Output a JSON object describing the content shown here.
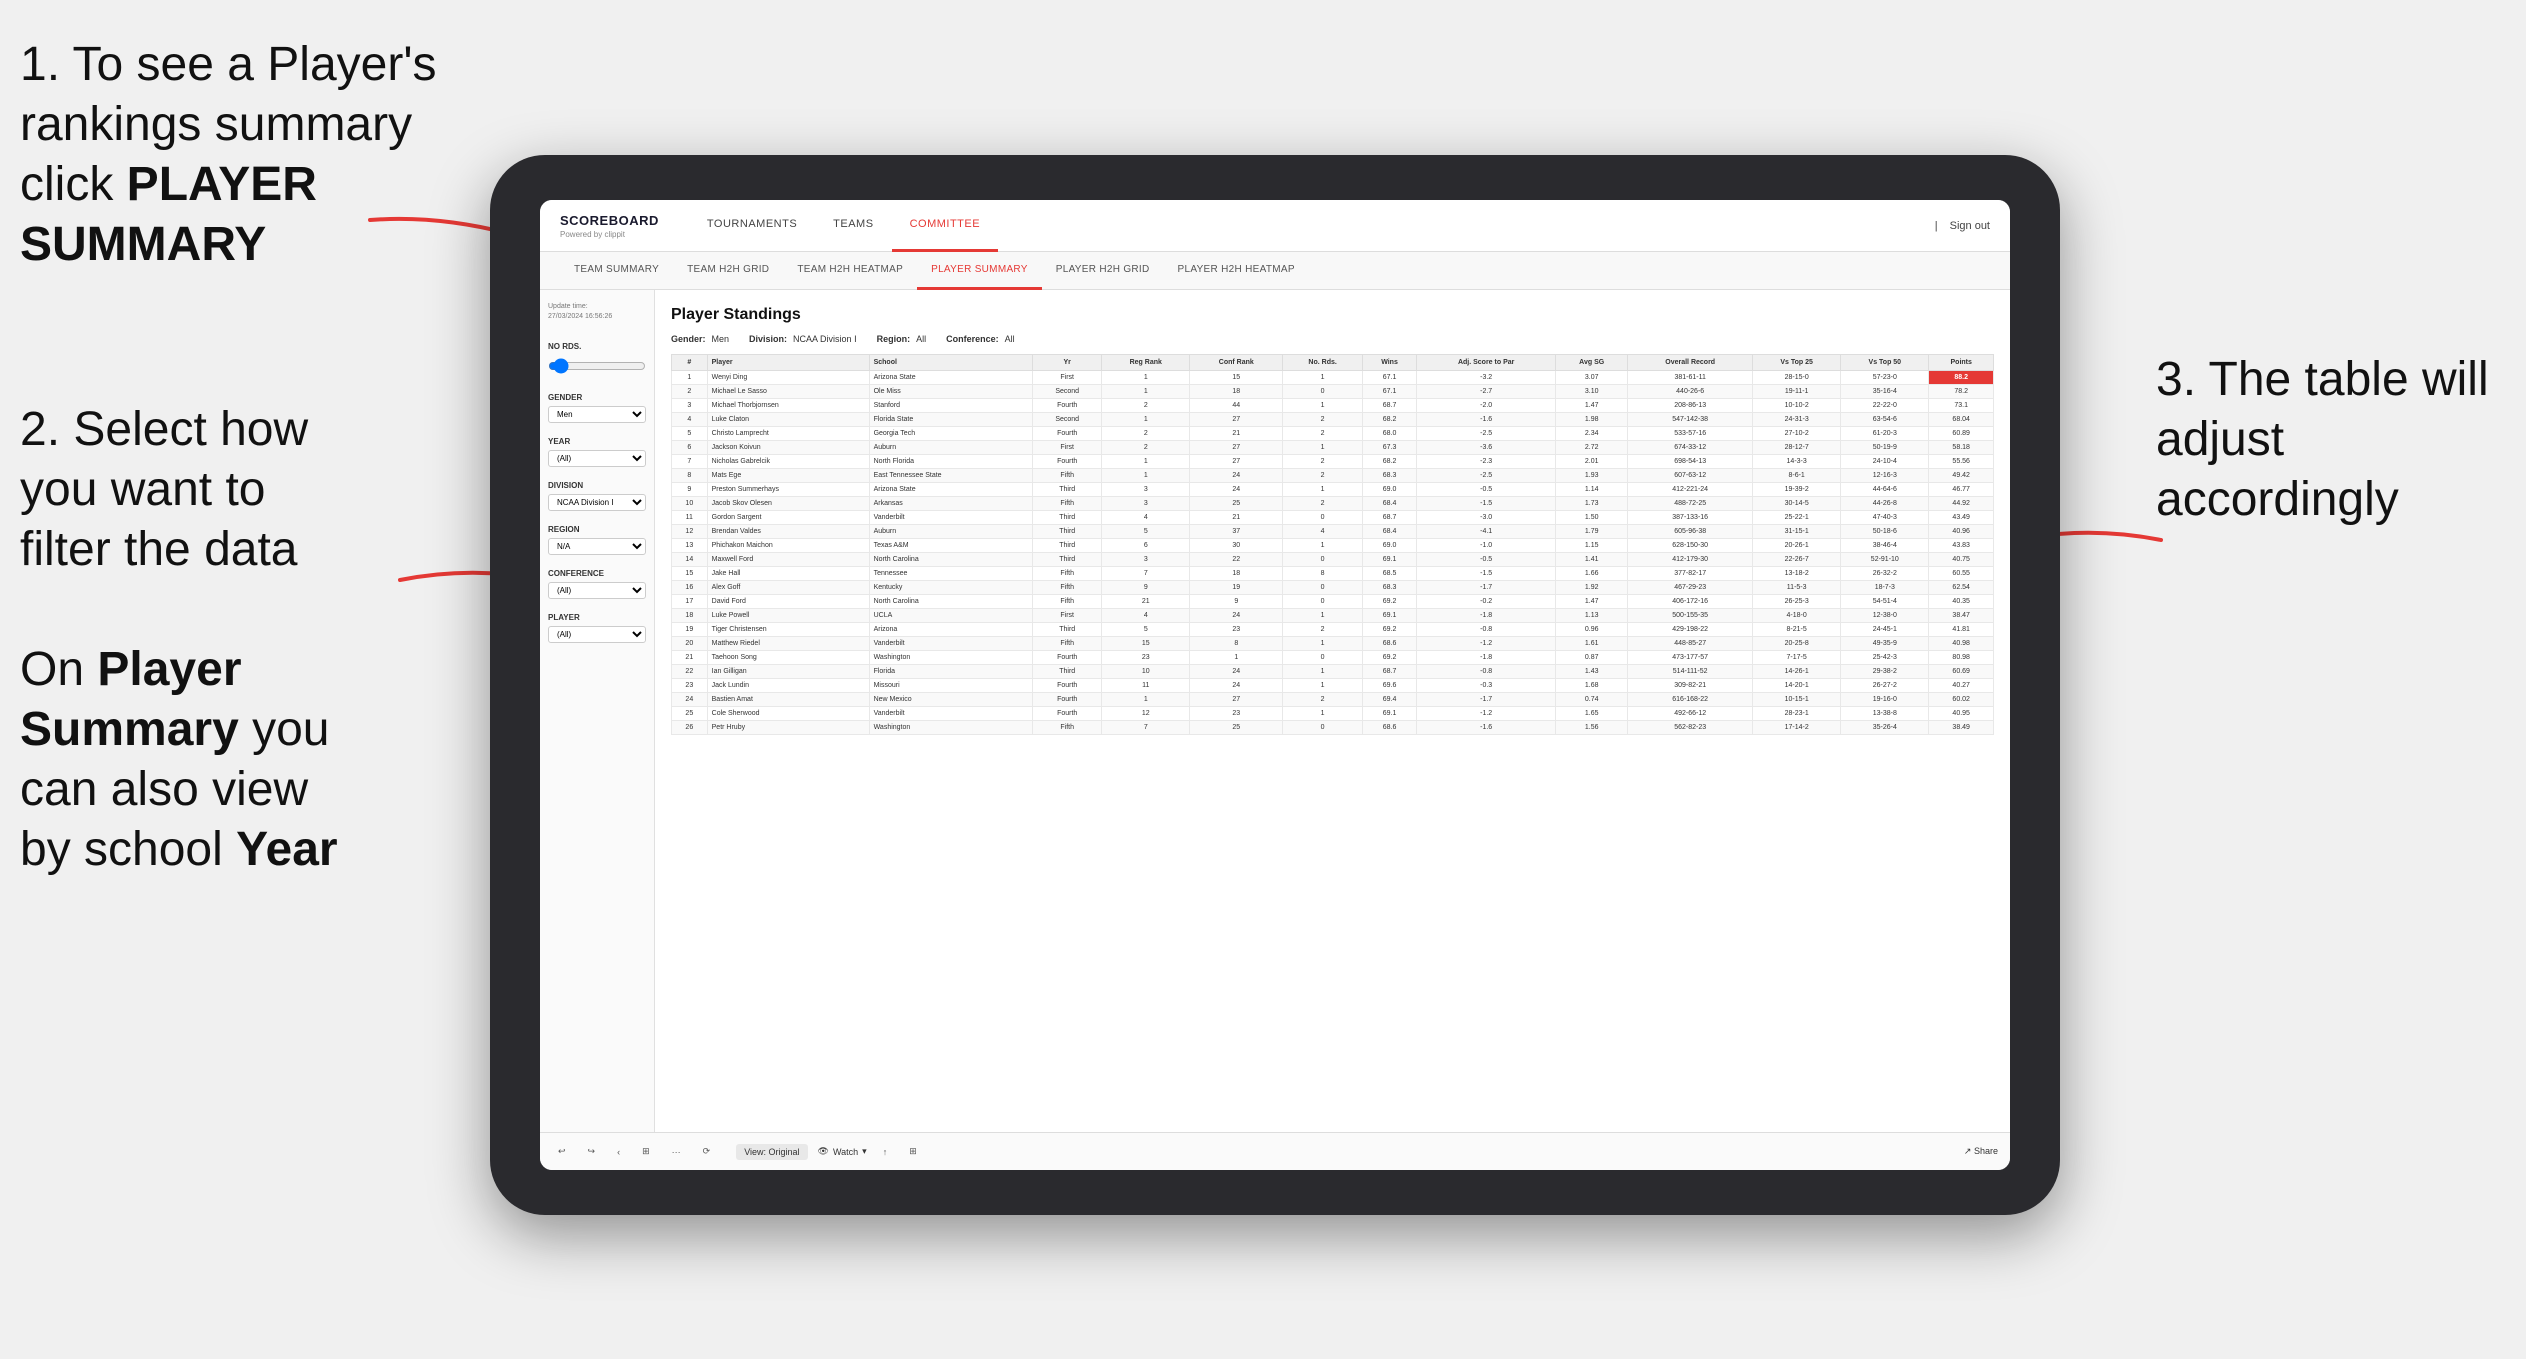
{
  "instructions": {
    "step1": "1. To see a Player's rankings summary click ",
    "step1_bold": "PLAYER SUMMARY",
    "step2_line1": "2. Select how",
    "step2_line2": "you want to",
    "step2_line3": "filter the data",
    "step3": "3. The table will adjust accordingly",
    "footer_line1": "On ",
    "footer_bold1": "Player",
    "footer_line2": "",
    "footer_bold2": "Summary",
    "footer_line3": " you",
    "footer_line4": "can also view",
    "footer_line5": "by school ",
    "footer_bold3": "Year"
  },
  "app": {
    "logo": "SCOREBOARD",
    "logo_sub": "Powered by clippit",
    "nav": [
      "TOURNAMENTS",
      "TEAMS",
      "COMMITTEE"
    ],
    "nav_active": "TEAMS",
    "header_right": [
      "Sign out"
    ],
    "subnav": [
      "TEAM SUMMARY",
      "TEAM H2H GRID",
      "TEAM H2H HEATMAP",
      "PLAYER SUMMARY",
      "PLAYER H2H GRID",
      "PLAYER H2H HEATMAP"
    ],
    "subnav_active": "PLAYER SUMMARY"
  },
  "sidebar": {
    "update_label": "Update time:",
    "update_time": "27/03/2024 16:56:26",
    "no_rds_label": "No Rds.",
    "gender_label": "Gender",
    "gender_value": "Men",
    "year_label": "Year",
    "year_value": "(All)",
    "division_label": "Division",
    "division_value": "NCAA Division I",
    "region_label": "Region",
    "region_value": "N/A",
    "conference_label": "Conference",
    "conference_value": "(All)",
    "player_label": "Player",
    "player_value": "(All)"
  },
  "standings": {
    "title": "Player Standings",
    "gender_label": "Gender:",
    "gender_value": "Men",
    "division_label": "Division:",
    "division_value": "NCAA Division I",
    "region_label": "Region:",
    "region_value": "All",
    "conference_label": "Conference:",
    "conference_value": "All",
    "columns": [
      "#",
      "Player",
      "School",
      "Yr",
      "Reg Rank",
      "Conf Rank",
      "No. Rds.",
      "Wins",
      "Adj. Score to Par",
      "Avg SG",
      "Overall Record",
      "Vs Top 25",
      "Vs Top 50",
      "Points"
    ],
    "players": [
      {
        "rank": "1",
        "name": "Wenyi Ding",
        "school": "Arizona State",
        "yr": "First",
        "reg_rank": "1",
        "conf_rank": "15",
        "rds": "1",
        "wins": "67.1",
        "adj": "-3.2",
        "sg": "3.07",
        "record": "381-61-11",
        "vt25": "28-15-0",
        "vt50": "57-23-0",
        "points": "88.2"
      },
      {
        "rank": "2",
        "name": "Michael Le Sasso",
        "school": "Ole Miss",
        "yr": "Second",
        "reg_rank": "1",
        "conf_rank": "18",
        "rds": "0",
        "wins": "67.1",
        "adj": "-2.7",
        "sg": "3.10",
        "record": "440-26-6",
        "vt25": "19-11-1",
        "vt50": "35-16-4",
        "points": "78.2"
      },
      {
        "rank": "3",
        "name": "Michael Thorbjornsen",
        "school": "Stanford",
        "yr": "Fourth",
        "reg_rank": "2",
        "conf_rank": "44",
        "rds": "1",
        "wins": "68.7",
        "adj": "-2.0",
        "sg": "1.47",
        "record": "208-86-13",
        "vt25": "10-10-2",
        "vt50": "22-22-0",
        "points": "73.1"
      },
      {
        "rank": "4",
        "name": "Luke Claton",
        "school": "Florida State",
        "yr": "Second",
        "reg_rank": "1",
        "conf_rank": "27",
        "rds": "2",
        "wins": "68.2",
        "adj": "-1.6",
        "sg": "1.98",
        "record": "547-142-38",
        "vt25": "24-31-3",
        "vt50": "63-54-6",
        "points": "68.04"
      },
      {
        "rank": "5",
        "name": "Christo Lamprecht",
        "school": "Georgia Tech",
        "yr": "Fourth",
        "reg_rank": "2",
        "conf_rank": "21",
        "rds": "2",
        "wins": "68.0",
        "adj": "-2.5",
        "sg": "2.34",
        "record": "533-57-16",
        "vt25": "27-10-2",
        "vt50": "61-20-3",
        "points": "60.89"
      },
      {
        "rank": "6",
        "name": "Jackson Koivun",
        "school": "Auburn",
        "yr": "First",
        "reg_rank": "2",
        "conf_rank": "27",
        "rds": "1",
        "wins": "67.3",
        "adj": "-3.6",
        "sg": "2.72",
        "record": "674-33-12",
        "vt25": "28-12-7",
        "vt50": "50-19-9",
        "points": "58.18"
      },
      {
        "rank": "7",
        "name": "Nicholas Gabrelcik",
        "school": "North Florida",
        "yr": "Fourth",
        "reg_rank": "1",
        "conf_rank": "27",
        "rds": "2",
        "wins": "68.2",
        "adj": "-2.3",
        "sg": "2.01",
        "record": "698-54-13",
        "vt25": "14-3-3",
        "vt50": "24-10-4",
        "points": "55.56"
      },
      {
        "rank": "8",
        "name": "Mats Ege",
        "school": "East Tennessee State",
        "yr": "Fifth",
        "reg_rank": "1",
        "conf_rank": "24",
        "rds": "2",
        "wins": "68.3",
        "adj": "-2.5",
        "sg": "1.93",
        "record": "607-63-12",
        "vt25": "8-6-1",
        "vt50": "12-16-3",
        "points": "49.42"
      },
      {
        "rank": "9",
        "name": "Preston Summerhays",
        "school": "Arizona State",
        "yr": "Third",
        "reg_rank": "3",
        "conf_rank": "24",
        "rds": "1",
        "wins": "69.0",
        "adj": "-0.5",
        "sg": "1.14",
        "record": "412-221-24",
        "vt25": "19-39-2",
        "vt50": "44-64-6",
        "points": "46.77"
      },
      {
        "rank": "10",
        "name": "Jacob Skov Olesen",
        "school": "Arkansas",
        "yr": "Fifth",
        "reg_rank": "3",
        "conf_rank": "25",
        "rds": "2",
        "wins": "68.4",
        "adj": "-1.5",
        "sg": "1.73",
        "record": "488-72-25",
        "vt25": "30-14-5",
        "vt50": "44-26-8",
        "points": "44.92"
      },
      {
        "rank": "11",
        "name": "Gordon Sargent",
        "school": "Vanderbilt",
        "yr": "Third",
        "reg_rank": "4",
        "conf_rank": "21",
        "rds": "0",
        "wins": "68.7",
        "adj": "-3.0",
        "sg": "1.50",
        "record": "387-133-16",
        "vt25": "25-22-1",
        "vt50": "47-40-3",
        "points": "43.49"
      },
      {
        "rank": "12",
        "name": "Brendan Valdes",
        "school": "Auburn",
        "yr": "Third",
        "reg_rank": "5",
        "conf_rank": "37",
        "rds": "4",
        "wins": "68.4",
        "adj": "-4.1",
        "sg": "1.79",
        "record": "605-96-38",
        "vt25": "31-15-1",
        "vt50": "50-18-6",
        "points": "40.96"
      },
      {
        "rank": "13",
        "name": "Phichakon Maichon",
        "school": "Texas A&M",
        "yr": "Third",
        "reg_rank": "6",
        "conf_rank": "30",
        "rds": "1",
        "wins": "69.0",
        "adj": "-1.0",
        "sg": "1.15",
        "record": "628-150-30",
        "vt25": "20-26-1",
        "vt50": "38-46-4",
        "points": "43.83"
      },
      {
        "rank": "14",
        "name": "Maxwell Ford",
        "school": "North Carolina",
        "yr": "Third",
        "reg_rank": "3",
        "conf_rank": "22",
        "rds": "0",
        "wins": "69.1",
        "adj": "-0.5",
        "sg": "1.41",
        "record": "412-179-30",
        "vt25": "22-26-7",
        "vt50": "52-91-10",
        "points": "40.75"
      },
      {
        "rank": "15",
        "name": "Jake Hall",
        "school": "Tennessee",
        "yr": "Fifth",
        "reg_rank": "7",
        "conf_rank": "18",
        "rds": "8",
        "wins": "68.5",
        "adj": "-1.5",
        "sg": "1.66",
        "record": "377-82-17",
        "vt25": "13-18-2",
        "vt50": "26-32-2",
        "points": "60.55"
      },
      {
        "rank": "16",
        "name": "Alex Goff",
        "school": "Kentucky",
        "yr": "Fifth",
        "reg_rank": "9",
        "conf_rank": "19",
        "rds": "0",
        "wins": "68.3",
        "adj": "-1.7",
        "sg": "1.92",
        "record": "467-29-23",
        "vt25": "11-5-3",
        "vt50": "18-7-3",
        "points": "62.54"
      },
      {
        "rank": "17",
        "name": "David Ford",
        "school": "North Carolina",
        "yr": "Fifth",
        "reg_rank": "21",
        "conf_rank": "9",
        "rds": "0",
        "wins": "69.2",
        "adj": "-0.2",
        "sg": "1.47",
        "record": "406-172-16",
        "vt25": "26-25-3",
        "vt50": "54-51-4",
        "points": "40.35"
      },
      {
        "rank": "18",
        "name": "Luke Powell",
        "school": "UCLA",
        "yr": "First",
        "reg_rank": "4",
        "conf_rank": "24",
        "rds": "1",
        "wins": "69.1",
        "adj": "-1.8",
        "sg": "1.13",
        "record": "500-155-35",
        "vt25": "4-18-0",
        "vt50": "12-38-0",
        "points": "38.47"
      },
      {
        "rank": "19",
        "name": "Tiger Christensen",
        "school": "Arizona",
        "yr": "Third",
        "reg_rank": "5",
        "conf_rank": "23",
        "rds": "2",
        "wins": "69.2",
        "adj": "-0.8",
        "sg": "0.96",
        "record": "429-198-22",
        "vt25": "8-21-5",
        "vt50": "24-45-1",
        "points": "41.81"
      },
      {
        "rank": "20",
        "name": "Matthew Riedel",
        "school": "Vanderbilt",
        "yr": "Fifth",
        "reg_rank": "15",
        "conf_rank": "8",
        "rds": "1",
        "wins": "68.6",
        "adj": "-1.2",
        "sg": "1.61",
        "record": "448-85-27",
        "vt25": "20-25-8",
        "vt50": "49-35-9",
        "points": "40.98"
      },
      {
        "rank": "21",
        "name": "Taehoon Song",
        "school": "Washington",
        "yr": "Fourth",
        "reg_rank": "23",
        "conf_rank": "1",
        "rds": "0",
        "wins": "69.2",
        "adj": "-1.8",
        "sg": "0.87",
        "record": "473-177-57",
        "vt25": "7-17-5",
        "vt50": "25-42-3",
        "points": "80.98"
      },
      {
        "rank": "22",
        "name": "Ian Gilligan",
        "school": "Florida",
        "yr": "Third",
        "reg_rank": "10",
        "conf_rank": "24",
        "rds": "1",
        "wins": "68.7",
        "adj": "-0.8",
        "sg": "1.43",
        "record": "514-111-52",
        "vt25": "14-26-1",
        "vt50": "29-38-2",
        "points": "60.69"
      },
      {
        "rank": "23",
        "name": "Jack Lundin",
        "school": "Missouri",
        "yr": "Fourth",
        "reg_rank": "11",
        "conf_rank": "24",
        "rds": "1",
        "wins": "69.6",
        "adj": "-0.3",
        "sg": "1.68",
        "record": "309-82-21",
        "vt25": "14-20-1",
        "vt50": "26-27-2",
        "points": "40.27"
      },
      {
        "rank": "24",
        "name": "Bastien Amat",
        "school": "New Mexico",
        "yr": "Fourth",
        "reg_rank": "1",
        "conf_rank": "27",
        "rds": "2",
        "wins": "69.4",
        "adj": "-1.7",
        "sg": "0.74",
        "record": "616-168-22",
        "vt25": "10-15-1",
        "vt50": "19-16-0",
        "points": "60.02"
      },
      {
        "rank": "25",
        "name": "Cole Sherwood",
        "school": "Vanderbilt",
        "yr": "Fourth",
        "reg_rank": "12",
        "conf_rank": "23",
        "rds": "1",
        "wins": "69.1",
        "adj": "-1.2",
        "sg": "1.65",
        "record": "492-66-12",
        "vt25": "28-23-1",
        "vt50": "13-38-8",
        "points": "40.95"
      },
      {
        "rank": "26",
        "name": "Petr Hruby",
        "school": "Washington",
        "yr": "Fifth",
        "reg_rank": "7",
        "conf_rank": "25",
        "rds": "0",
        "wins": "68.6",
        "adj": "-1.6",
        "sg": "1.56",
        "record": "562-82-23",
        "vt25": "17-14-2",
        "vt50": "35-26-4",
        "points": "38.49"
      }
    ]
  },
  "toolbar": {
    "view_label": "View: Original",
    "watch_label": "Watch",
    "share_label": "Share"
  }
}
